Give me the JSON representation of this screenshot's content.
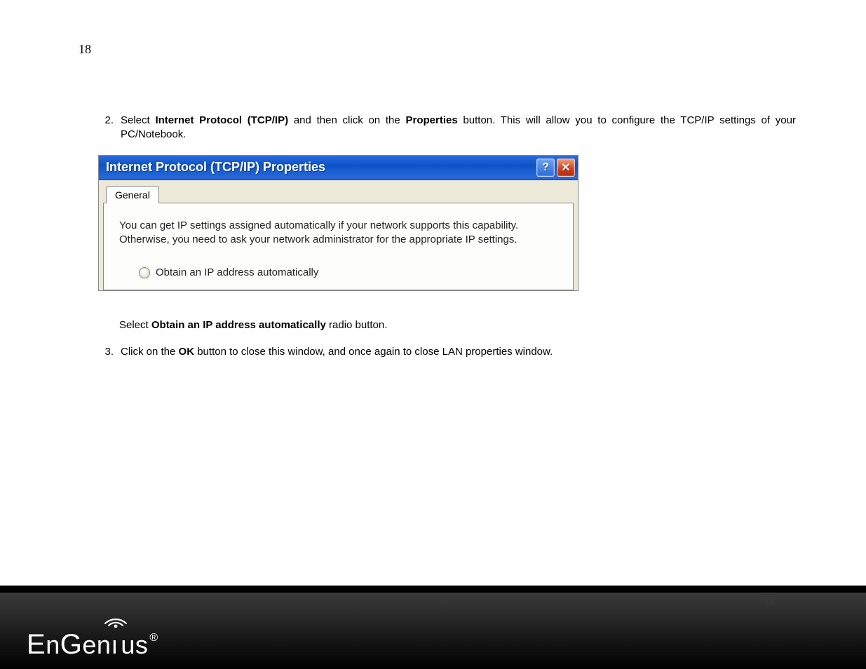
{
  "page": {
    "numberTop": "18",
    "numberFooter": "18"
  },
  "steps": {
    "s2": {
      "num": "2.",
      "pre": "Select ",
      "bold1": "Internet Protocol (TCP/IP)",
      "mid": " and then click on the ",
      "bold2": "Properties",
      "post": " button. This will allow you to configure the TCP/IP settings of your PC/Notebook."
    },
    "sSelect": {
      "pre": "Select ",
      "bold": "Obtain an IP address automatically",
      "post": " radio button."
    },
    "s3": {
      "num": "3.",
      "pre": "Click on the ",
      "bold": "OK",
      "post": " button to close this window, and once again to close LAN properties window."
    }
  },
  "dialog": {
    "title": "Internet Protocol (TCP/IP) Properties",
    "tab": "General",
    "description": "You can get IP settings assigned automatically if your network supports this capability. Otherwise, you need to ask your network administrator for the appropriate IP settings.",
    "radioLabel": "Obtain an IP address automatically"
  },
  "brand": {
    "name": "EnGenius"
  }
}
